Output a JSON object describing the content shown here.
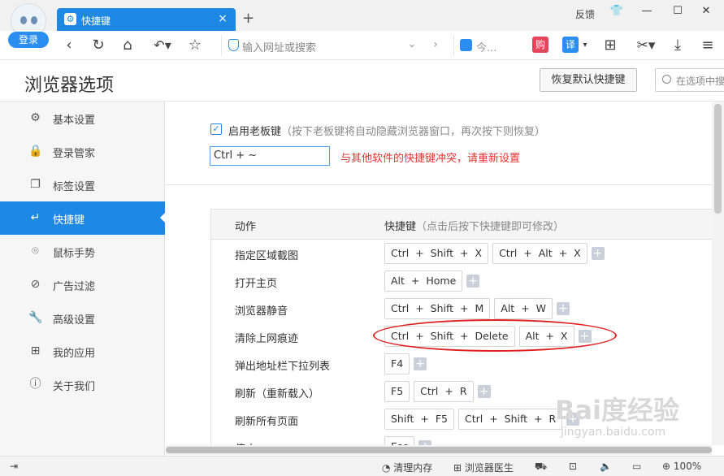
{
  "browser": {
    "login_label": "登录",
    "tab_title": "快捷键",
    "tab_close": "×",
    "new_tab": "+",
    "feedback": "反馈",
    "address_placeholder": "输入网址或搜索",
    "search_text": "今...",
    "gou": "购",
    "yi": "译"
  },
  "page": {
    "title": "浏览器选项",
    "restore_button": "恢复默认快捷键",
    "search_placeholder": "在选项中搜"
  },
  "sidebar": {
    "items": [
      {
        "label": "基本设置",
        "icon": "gear-icon",
        "glyph": "⚙"
      },
      {
        "label": "登录管家",
        "icon": "lock-icon",
        "glyph": "🔒"
      },
      {
        "label": "标签设置",
        "icon": "tabs-icon",
        "glyph": "❐"
      },
      {
        "label": "快捷键",
        "icon": "shortcut-icon",
        "glyph": "↵",
        "active": true
      },
      {
        "label": "鼠标手势",
        "icon": "mouse-icon",
        "glyph": "⌾"
      },
      {
        "label": "广告过滤",
        "icon": "block-icon",
        "glyph": "⊘"
      },
      {
        "label": "高级设置",
        "icon": "wrench-icon",
        "glyph": "🔧"
      },
      {
        "label": "我的应用",
        "icon": "apps-icon",
        "glyph": "⊞"
      },
      {
        "label": "关于我们",
        "icon": "info-icon",
        "glyph": "ⓘ"
      }
    ]
  },
  "boss_key": {
    "checked": true,
    "label": "启用老板键",
    "hint": "（按下老板键将自动隐藏浏览器窗口，再次按下则恢复）",
    "value": "Ctrl + ~",
    "conflict": "与其他软件的快捷键冲突，请重新设置"
  },
  "table": {
    "col_action": "动作",
    "col_shortcut": "快捷键",
    "col_shortcut_hint": "（点击后按下快捷键即可修改）",
    "rows": [
      {
        "action": "指定区域截图",
        "keys": [
          "Ctrl + Shift + X",
          "Ctrl + Alt + X"
        ]
      },
      {
        "action": "打开主页",
        "keys": [
          "Alt + Home"
        ]
      },
      {
        "action": "浏览器静音",
        "keys": [
          "Ctrl + Shift + M",
          "Alt + W"
        ]
      },
      {
        "action": "清除上网痕迹",
        "keys": [
          "Ctrl + Shift + Delete",
          "Alt + X"
        ]
      },
      {
        "action": "弹出地址栏下拉列表",
        "keys": [
          "F4"
        ]
      },
      {
        "action": "刷新（重新载入）",
        "keys": [
          "F5",
          "Ctrl + R"
        ]
      },
      {
        "action": "刷新所有页面",
        "keys": [
          "Shift + F5",
          "Ctrl + Shift + R"
        ]
      },
      {
        "action": "停止",
        "keys": [
          "Esc"
        ]
      }
    ]
  },
  "statusbar": {
    "clean_memory": "清理内存",
    "doctor": "浏览器医生",
    "zoom": "100%"
  },
  "watermark": {
    "brand": "Bai度经验",
    "url": "jingyan.baidu.com"
  }
}
